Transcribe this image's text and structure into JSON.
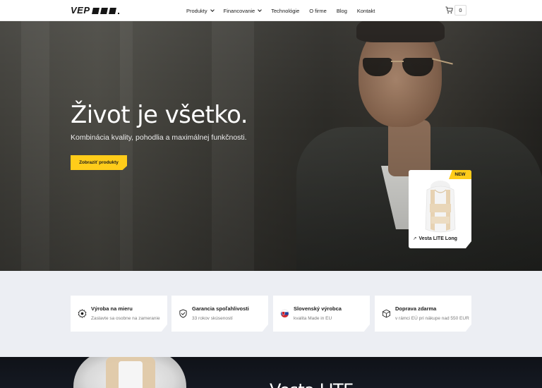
{
  "header": {
    "logo": "VEP",
    "nav": [
      {
        "label": "Produkty",
        "has_dropdown": true
      },
      {
        "label": "Financovanie",
        "has_dropdown": true
      },
      {
        "label": "Technológie",
        "has_dropdown": false
      },
      {
        "label": "O firme",
        "has_dropdown": false
      },
      {
        "label": "Blog",
        "has_dropdown": false
      },
      {
        "label": "Kontakt",
        "has_dropdown": false
      }
    ],
    "cart": {
      "icon": "cart-icon",
      "count": "0"
    }
  },
  "hero": {
    "title": "Život je všetko.",
    "subtitle": "Kombinácia kvality, pohodlia a maximálnej funkčnosti.",
    "cta_label": "Zobraziť produkty",
    "accent_color": "#ffcc1a"
  },
  "product_card": {
    "badge": "NEW",
    "link_label": "Vesta LITE Long",
    "arrow_icon": "arrow-up-right-icon"
  },
  "features": [
    {
      "icon": "gear-badge-icon",
      "title": "Výroba na mieru",
      "description": "Zaslavte sa osobne na zameranie"
    },
    {
      "icon": "shield-check-icon",
      "title": "Garancia spoľahlivosti",
      "description": "33 rokov skúseností"
    },
    {
      "icon": "slovak-flag-icon",
      "title": "Slovenský výrobca",
      "description": "kvalita Made in EU"
    },
    {
      "icon": "box-icon",
      "title": "Doprava zdarma",
      "description": "v rámci EÚ pri nákupe nad 550 EUR"
    }
  ],
  "bottom_section": {
    "title_partial": "Vesta LITE"
  }
}
